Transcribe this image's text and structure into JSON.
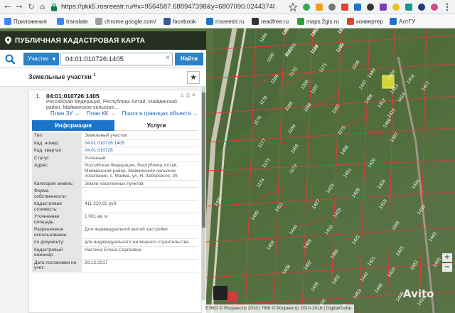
{
  "browser": {
    "url": "https://pkk5.rosreestr.ru/#x=9564587.688947398&y=6807090.024437481&z...",
    "bookmarks": [
      {
        "label": "Приложения",
        "color": "#4285f4"
      },
      {
        "label": "translate",
        "color": "#4285f4"
      },
      {
        "label": "chrome.google.com/",
        "color": "#9e9e9e"
      },
      {
        "label": "facebook",
        "color": "#3b5998"
      },
      {
        "label": "rosreestr.ru",
        "color": "#1c74c8"
      },
      {
        "label": "readfree.ru",
        "color": "#333333"
      },
      {
        "label": "maps.2gis.ru",
        "color": "#2e9e3f"
      },
      {
        "label": "конвертер",
        "color": "#e0452c"
      },
      {
        "label": "АлтГУ",
        "color": "#1c74c8"
      }
    ]
  },
  "header": {
    "title": "ПУБЛИЧНАЯ КАДАСТРОВАЯ КАРТА"
  },
  "search": {
    "type_label": "Участки",
    "value": "04:01:010726:1405",
    "button_label": "Найти"
  },
  "results": {
    "title": "Земельные участки",
    "count": "1"
  },
  "card": {
    "index": "1.",
    "cad_number": "04:01:010726:1405",
    "address_short": "Российская Федерация, Республика Алтай, Майминский район, Майминское сельское...",
    "links": [
      "План ЗУ →",
      "План КК →",
      "Поиск в границах объекта →"
    ]
  },
  "tabs": {
    "info": "Информация",
    "services": "Услуги"
  },
  "info_rows": [
    {
      "k": "Тип:",
      "v": "Земельный участок",
      "blue": false
    },
    {
      "k": "Кад. номер:",
      "v": "04:01:010726:1405",
      "blue": true
    },
    {
      "k": "Кад. квартал:",
      "v": "04:01:010726",
      "blue": true
    },
    {
      "k": "Статус:",
      "v": "Учтенный",
      "blue": false
    },
    {
      "k": "Адрес:",
      "v": "Российская Федерация, Республика Алтай, Майминский район, Майминское сельское поселение, с. Майма, ул. Н. Заборского, 35",
      "blue": false
    },
    {
      "k": "Категория земель:",
      "v": "Земли населенных пунктов",
      "blue": false
    },
    {
      "k": "Форма собственности:",
      "v": "-",
      "blue": false
    },
    {
      "k": "Кадастровая стоимость:",
      "v": "411 320,82 руб.",
      "blue": false
    },
    {
      "k": "Уточненная площадь:",
      "v": "1 001 кв. м",
      "blue": false
    },
    {
      "k": "Разрешенное использование:",
      "v": "Для индивидуальной жилой застройки",
      "blue": false
    },
    {
      "k": "по документу:",
      "v": "для индивидуального жилищного строительства",
      "blue": false
    },
    {
      "k": "Кадастровый инженер:",
      "v": "Настина Елена Сергеевна",
      "blue": false
    },
    {
      "k": "Дата постановки на учет:",
      "v": "29.12.2017",
      "blue": false
    }
  ],
  "footer": {
    "attribution": "ЕЭКО © Росреестр 2010 | ПКК © Росреестр 2010-2016 | DigitalGlobe"
  },
  "watermark": "Avito",
  "map_labels": [
    "1192",
    "1191",
    "1210",
    "1181",
    "1180",
    "1179",
    "1170",
    "1171",
    "1169",
    "1189",
    "1190",
    "1186",
    "1187",
    "1188",
    "1440",
    "1437",
    "1408",
    "1413",
    "1412",
    "1415",
    "1466",
    "1414",
    "1416",
    "1417",
    "1405",
    "1407",
    "1200",
    "1178",
    "1176",
    "1185",
    "1184",
    "1183",
    "1177",
    "1173",
    "1172",
    "1174",
    "1182",
    "1175",
    "1450",
    "1451",
    "1429",
    "1428",
    "1426",
    "1424",
    "1425",
    "1427",
    "1430",
    "1431",
    "1409",
    "1410",
    "1411",
    "1418",
    "1165",
    "1423",
    "1434",
    "1435",
    "1443",
    "1444",
    "1403",
    "1402",
    "1396",
    "1422",
    "1421",
    "1420",
    "1432",
    "1433",
    "1438",
    "1439",
    "1452",
    "1453",
    "1448",
    "1449",
    "1419",
    "1436",
    "1441",
    "1442",
    "1445",
    "1446",
    "1447",
    "1454",
    "1455",
    "1456",
    "010701",
    "1124",
    "1199"
  ]
}
